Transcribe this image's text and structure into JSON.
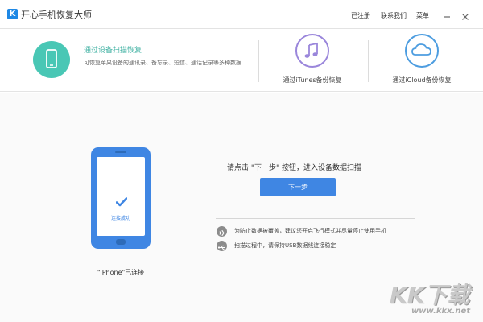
{
  "app": {
    "logo_letter": "K",
    "title": "开心手机恢复大师"
  },
  "titlebar": {
    "registered": "已注册",
    "contact": "联系我们",
    "menu": "菜单",
    "minimize_icon": "minimize-icon",
    "close_icon": "close-icon"
  },
  "modes": {
    "active": {
      "title": "通过设备扫描恢复",
      "description": "可恢复苹果设备的通讯录、备忘录、短信、通话记录等多种数据",
      "icon": "phone-icon",
      "icon_color": "#49c7b5"
    },
    "itunes": {
      "label": "通过iTunes备份恢复",
      "icon": "music-note-icon",
      "icon_color": "#9a86db"
    },
    "icloud": {
      "label": "通过iCloud备份恢复",
      "icon": "cloud-icon",
      "icon_color": "#4d9de0"
    }
  },
  "device": {
    "status": "连接成功",
    "caption": "\"iPhone\"已连接",
    "phone_color": "#3f86e3"
  },
  "main": {
    "instruction": "请点击 \"下一步\" 按钮，进入设备数据扫描",
    "next_button": "下一步"
  },
  "tips": [
    {
      "icon": "airplane-icon",
      "text": "为防止数据被覆盖，建议您开启飞行模式并尽量停止使用手机"
    },
    {
      "icon": "usb-icon",
      "text": "扫描过程中，请保持USB数据线连接稳定"
    }
  ],
  "watermark": {
    "logo": "KK下载",
    "url": "www.kkx.net"
  },
  "colors": {
    "accent": "#3f86e3",
    "teal": "#49c7b5"
  }
}
